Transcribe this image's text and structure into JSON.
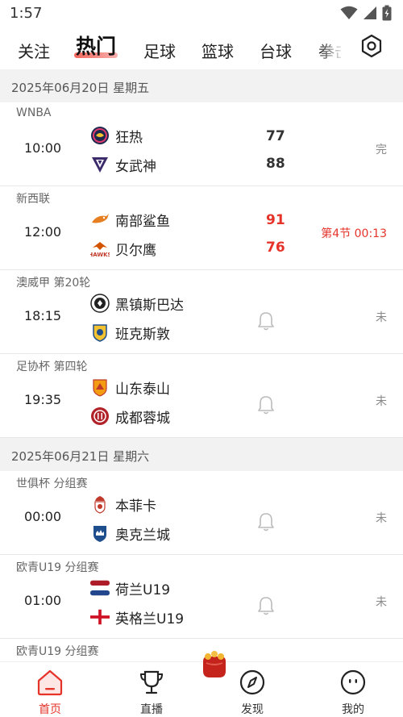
{
  "status_bar": {
    "time": "1:57"
  },
  "top_nav": {
    "tabs": [
      {
        "label": "关注",
        "active": false
      },
      {
        "label": "热门",
        "active": true
      },
      {
        "label": "足球",
        "active": false
      },
      {
        "label": "篮球",
        "active": false
      },
      {
        "label": "台球",
        "active": false
      },
      {
        "label": "拳击",
        "active": false
      }
    ]
  },
  "sections": [
    {
      "date": "2025年06月20日   星期五",
      "matches": [
        {
          "league": "WNBA",
          "time": "10:00",
          "home": "狂热",
          "away": "女武神",
          "home_score": "77",
          "away_score": "88",
          "status": "完",
          "live": false
        },
        {
          "league": "新西联",
          "time": "12:00",
          "home": "南部鲨鱼",
          "away": "贝尔鹰",
          "home_score": "91",
          "away_score": "76",
          "status": "第4节  00:13",
          "live": true
        },
        {
          "league": "澳威甲   第20轮",
          "time": "18:15",
          "home": "黑镇斯巴达",
          "away": "班克斯敦",
          "home_score": "",
          "away_score": "",
          "status": "未",
          "live": false
        },
        {
          "league": "足协杯 第四轮",
          "time": "19:35",
          "home": "山东泰山",
          "away": "成都蓉城",
          "home_score": "",
          "away_score": "",
          "status": "未",
          "live": false
        }
      ]
    },
    {
      "date": "2025年06月21日   星期六",
      "matches": [
        {
          "league": "世俱杯 分组赛",
          "time": "00:00",
          "home": "本菲卡",
          "away": "奥克兰城",
          "home_score": "",
          "away_score": "",
          "status": "未",
          "live": false
        },
        {
          "league": "欧青U19 分组赛",
          "time": "01:00",
          "home": "荷兰U19",
          "away": "英格兰U19",
          "home_score": "",
          "away_score": "",
          "status": "未",
          "live": false
        },
        {
          "league": "欧青U19 分组赛",
          "time": "",
          "home": "",
          "away": "",
          "home_score": "",
          "away_score": "",
          "status": "",
          "live": false
        }
      ]
    }
  ],
  "bottom_nav": {
    "items": [
      {
        "label": "首页",
        "icon": "home-icon",
        "active": true
      },
      {
        "label": "直播",
        "icon": "trophy-icon",
        "active": false
      },
      {
        "label": "发现",
        "icon": "compass-icon",
        "active": false
      },
      {
        "label": "我的",
        "icon": "profile-face-icon",
        "active": false
      }
    ]
  },
  "colors": {
    "accent": "#e6332a",
    "section_bg": "#f2f2f2"
  }
}
